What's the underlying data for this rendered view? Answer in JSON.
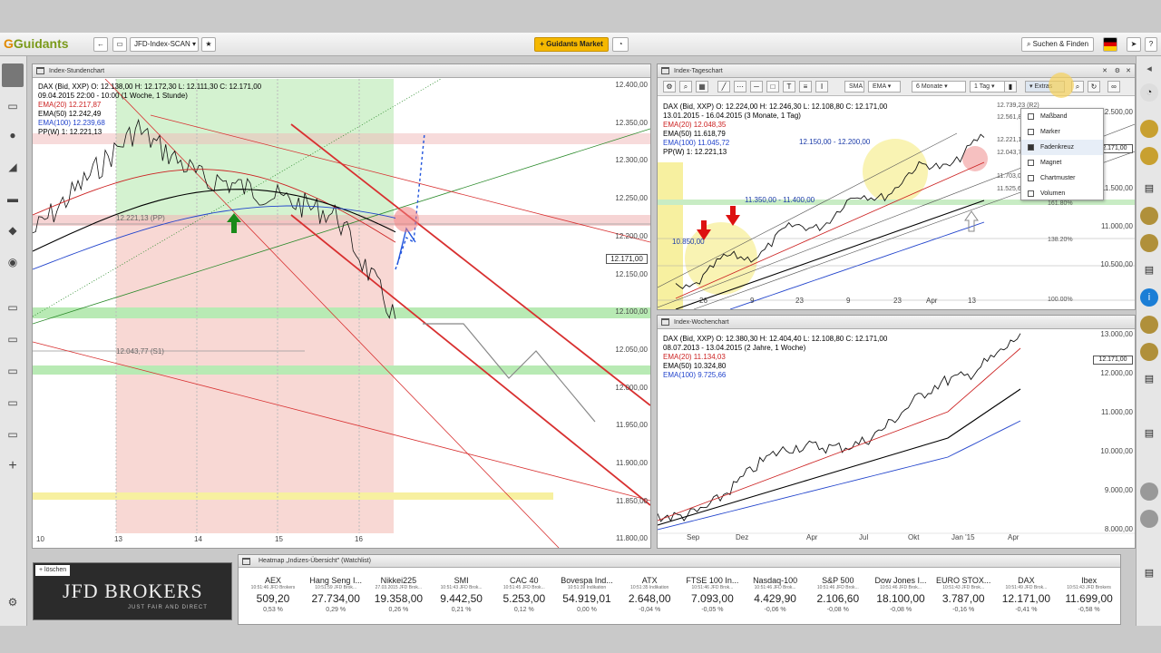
{
  "app": {
    "logo": "Guidants",
    "tab": "JFD-Index-SCAN",
    "market_button": "Guidants Market",
    "search": "Suchen & Finden"
  },
  "hourly": {
    "title": "Index-Stundenchart",
    "legend": [
      "DAX (Bid, XXP)  O: 12.138,00  H: 12.172,30  L: 12.111,30  C: 12.171,00",
      "09.04.2015 22:00 - 10:00 (1 Woche, 1 Stunde)",
      "EMA(20)  12.217,87",
      "EMA(50)  12.242,49",
      "EMA(100)  12.239,68",
      "PP(W)  1: 12.221,13"
    ],
    "legend_colors": [
      "#000000",
      "#000000",
      "#cc2222",
      "#000000",
      "#2244cc",
      "#000000"
    ],
    "yticks": [
      "12.400,00",
      "12.350,00",
      "12.300,00",
      "12.250,00",
      "12.200,00",
      "12.150,00",
      "12.100,00",
      "12.050,00",
      "12.000,00",
      "11.950,00",
      "11.900,00",
      "11.850,00",
      "11.800,00"
    ],
    "xticks": [
      "10",
      "13",
      "14",
      "15",
      "16"
    ],
    "price_tag": "12.171,00",
    "pp_label": "12.221,13 (PP)",
    "s1_label": "12.043,77 (S1)"
  },
  "daily": {
    "title": "Index-Tageschart",
    "toolbar": [
      "SMA",
      "EMA",
      "6 Monate",
      "1 Tag",
      "Extras"
    ],
    "legend": [
      "DAX (Bid, XXP)  O: 12.224,00  H: 12.246,30  L: 12.108,80  C: 12.171,00",
      "13.01.2015 - 16.04.2015 (3 Monate, 1 Tag)",
      "EMA(20)  12.048,35",
      "EMA(50)  11.618,79",
      "EMA(100)  11.045,72",
      "PP(W)  1: 12.221,13"
    ],
    "legend_colors": [
      "#000000",
      "#000000",
      "#cc2222",
      "#000000",
      "#2244cc",
      "#000000"
    ],
    "yticks": [
      "12.500,00",
      "12.000,00",
      "11.500,00",
      "11.000,00",
      "10.500,00"
    ],
    "xticks": [
      "26",
      "9",
      "23",
      "9",
      "23",
      "Apr",
      "13"
    ],
    "labels": [
      "12.150,00 - 12.200,00",
      "11.350,00 - 11.400,00",
      "10.850,00"
    ],
    "right_labels": [
      "12.739,23 (R2)",
      "12.561,87 (R1)",
      "12.221,13 (PP)",
      "12.043,77 (S1)",
      "11.703,03 (S2)",
      "11.525,67 (S3)",
      "161.80%",
      "138.20%",
      "100.00%"
    ],
    "price_tag": "12.171,00"
  },
  "menu": [
    {
      "label": "Maßband",
      "checked": false
    },
    {
      "label": "Marker",
      "checked": false
    },
    {
      "label": "Fadenkreuz",
      "checked": true
    },
    {
      "label": "Magnet",
      "checked": false
    },
    {
      "label": "Chartmuster",
      "checked": false
    },
    {
      "label": "Volumen",
      "checked": false
    }
  ],
  "weekly": {
    "title": "Index-Wochenchart",
    "legend": [
      "DAX (Bid, XXP)  O: 12.380,30  H: 12.404,40  L: 12.108,80  C: 12.171,00",
      "08.07.2013 - 13.04.2015 (2 Jahre, 1 Woche)",
      "EMA(20)  11.134,03",
      "EMA(50)  10.324,80",
      "EMA(100)  9.725,66"
    ],
    "legend_colors": [
      "#000000",
      "#000000",
      "#cc2222",
      "#000000",
      "#2244cc"
    ],
    "yticks": [
      "13.000,00",
      "12.000,00",
      "11.000,00",
      "10.000,00",
      "9.000,00",
      "8.000,00"
    ],
    "xticks": [
      "Sep",
      "Dez",
      "Apr",
      "Jul",
      "Okt",
      "Jan '15",
      "Apr"
    ],
    "price_tag": "12.171,00"
  },
  "heatmap": {
    "title": "Heatmap „Indizes-Übersicht\" (Watchlist)",
    "delete": "löschen",
    "tiles": [
      {
        "name": "AEX",
        "time": "10:51:46 JFD Brokers",
        "price": "509,20",
        "change": "0,53 %"
      },
      {
        "name": "Hang Seng I...",
        "time": "10:51:59 JFD Brok...",
        "price": "27.734,00",
        "change": "0,29 %"
      },
      {
        "name": "Nikkei225",
        "time": "27.03.2015 JFD Brok...",
        "price": "19.358,00",
        "change": "0,26 %"
      },
      {
        "name": "SMI",
        "time": "10:51:43 JFD Brok...",
        "price": "9.442,50",
        "change": "0,21 %"
      },
      {
        "name": "CAC 40",
        "time": "10:51:45 JFD Brok...",
        "price": "5.253,00",
        "change": "0,12 %"
      },
      {
        "name": "Bovespa Ind...",
        "time": "10:51:39 Indikation",
        "price": "54.919,01",
        "change": "0,00 %"
      },
      {
        "name": "ATX",
        "time": "10:51:35 Indikation",
        "price": "2.648,00",
        "change": "-0,04 %"
      },
      {
        "name": "FTSE 100 In...",
        "time": "10:51:46 JFD Brok...",
        "price": "7.093,00",
        "change": "-0,05 %"
      },
      {
        "name": "Nasdaq-100",
        "time": "10:51:46 JFD Brok...",
        "price": "4.429,90",
        "change": "-0,06 %"
      },
      {
        "name": "S&P 500",
        "time": "10:51:46 JFD Brok...",
        "price": "2.106,60",
        "change": "-0,08 %"
      },
      {
        "name": "Dow Jones I...",
        "time": "10:51:46 JFD Brok...",
        "price": "18.100,00",
        "change": "-0,08 %"
      },
      {
        "name": "EURO STOX...",
        "time": "10:51:43 JFD Brok...",
        "price": "3.787,00",
        "change": "-0,16 %"
      },
      {
        "name": "DAX",
        "time": "10:51:49 JFD Brok...",
        "price": "12.171,00",
        "change": "-0,41 %"
      },
      {
        "name": "Ibex",
        "time": "10:51:43 JFD Brokers",
        "price": "11.699,00",
        "change": "-0,58 %"
      }
    ]
  },
  "brand": {
    "name": "JFD BROKERS",
    "tagline": "JUST FAIR AND DIRECT"
  }
}
